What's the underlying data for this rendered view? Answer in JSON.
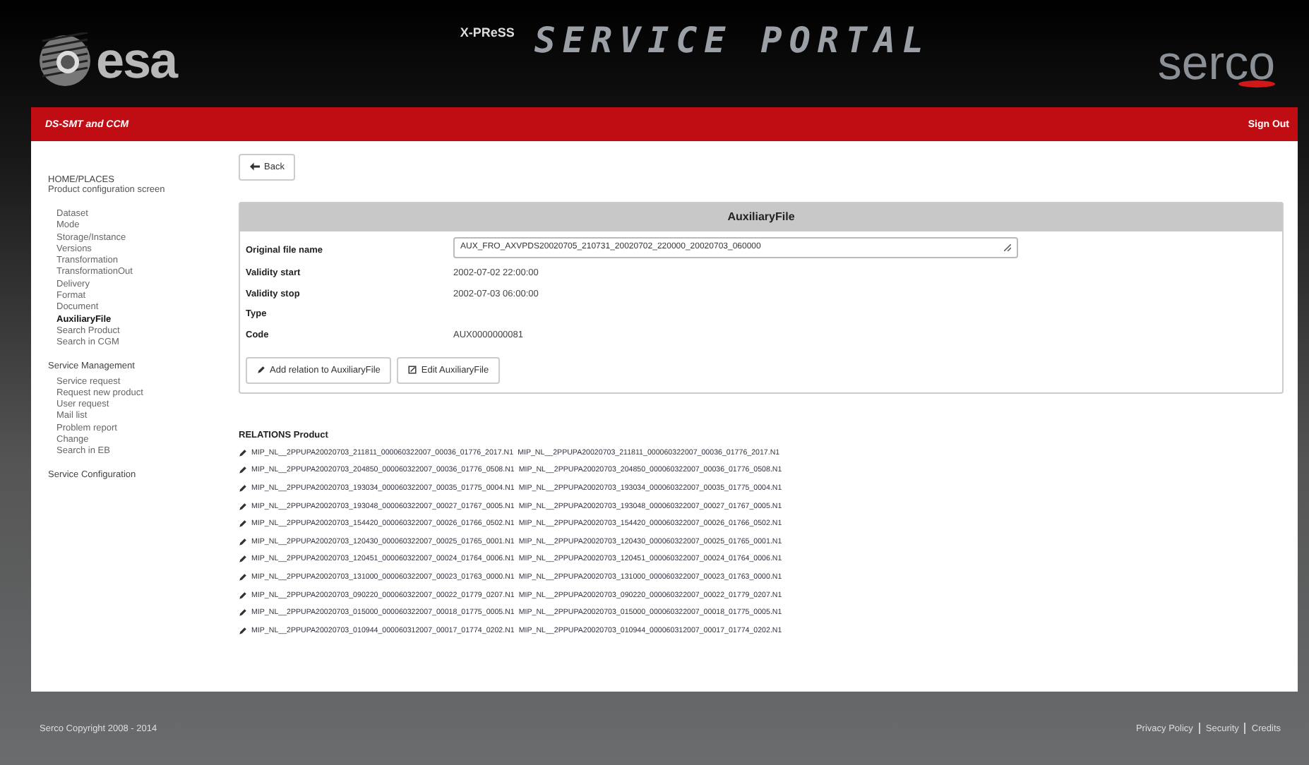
{
  "header": {
    "left_logo": "esa",
    "mission": "X-PReSS",
    "title": "SERVICE PORTAL",
    "right_logo": "serco"
  },
  "nav_bar": {
    "title": "DS-SMT and CCM",
    "sign_out": "Sign Out"
  },
  "sidebar": {
    "groups": [
      {
        "title": "HOME/PLACES",
        "subtitle": "Product configuration screen",
        "items": [
          {
            "label": "Dataset",
            "selected": false
          },
          {
            "label": "Mode",
            "selected": false
          },
          {
            "label": "Storage/Instance",
            "selected": false
          },
          {
            "label": "Versions",
            "selected": false
          },
          {
            "label": "Transformation",
            "selected": false
          },
          {
            "label": "TransformationOut",
            "selected": false
          },
          {
            "label": "Delivery",
            "selected": false
          },
          {
            "label": "Format",
            "selected": false
          },
          {
            "label": "Document",
            "selected": false
          },
          {
            "label": "AuxiliaryFile",
            "selected": true
          },
          {
            "label": "Search Product",
            "selected": false
          },
          {
            "label": "Search in CGM",
            "selected": false
          }
        ]
      },
      {
        "title": "Service Management",
        "items": [
          {
            "label": "Service request",
            "selected": false
          },
          {
            "label": "Request new product",
            "selected": false
          },
          {
            "label": "User request",
            "selected": false
          },
          {
            "label": "Mail list",
            "selected": false
          },
          {
            "label": "Problem report",
            "selected": false
          },
          {
            "label": "Change",
            "selected": false
          },
          {
            "label": "Search in EB",
            "selected": false
          }
        ]
      },
      {
        "title": "Service Configuration"
      }
    ]
  },
  "back_button": "Back",
  "panel": {
    "title": "AuxiliaryFile",
    "fields": [
      {
        "label": "Original file name",
        "kind": "input",
        "value": "AUX_FRO_AXVPDS20020705_210731_20020702_220000_20020703_060000"
      },
      {
        "label": "Validity start",
        "kind": "text",
        "value": "2002-07-02 22:00:00"
      },
      {
        "label": "Validity stop",
        "kind": "text",
        "value": "2002-07-03 06:00:00"
      },
      {
        "label": "Type",
        "kind": "text"
      },
      {
        "label": "Code",
        "kind": "text",
        "value": "AUX0000000081"
      }
    ],
    "buttons": [
      "Add relation to AuxiliaryFile",
      "Edit AuxiliaryFile"
    ]
  },
  "relations": {
    "title": "RELATIONS Product",
    "rows": [
      {
        "name": "MIP_NL__2PPUPA20020703_211811_000060322007_00036_01776_2017.N1",
        "file": "MIP_NL__2PPUPA20020703_211811_000060322007_00036_01776_2017.N1"
      },
      {
        "name": "MIP_NL__2PPUPA20020703_204850_000060322007_00036_01776_0508.N1",
        "file": "MIP_NL__2PPUPA20020703_204850_000060322007_00036_01776_0508.N1"
      },
      {
        "name": "MIP_NL__2PPUPA20020703_193034_000060322007_00035_01775_0004.N1",
        "file": "MIP_NL__2PPUPA20020703_193034_000060322007_00035_01775_0004.N1"
      },
      {
        "name": "MIP_NL__2PPUPA20020703_193048_000060322007_00027_01767_0005.N1",
        "file": "MIP_NL__2PPUPA20020703_193048_000060322007_00027_01767_0005.N1"
      },
      {
        "name": "MIP_NL__2PPUPA20020703_154420_000060322007_00026_01766_0502.N1",
        "file": "MIP_NL__2PPUPA20020703_154420_000060322007_00026_01766_0502.N1"
      },
      {
        "name": "MIP_NL__2PPUPA20020703_120430_000060322007_00025_01765_0001.N1",
        "file": "MIP_NL__2PPUPA20020703_120430_000060322007_00025_01765_0001.N1"
      },
      {
        "name": "MIP_NL__2PPUPA20020703_120451_000060322007_00024_01764_0006.N1",
        "file": "MIP_NL__2PPUPA20020703_120451_000060322007_00024_01764_0006.N1"
      },
      {
        "name": "MIP_NL__2PPUPA20020703_131000_000060322007_00023_01763_0000.N1",
        "file": "MIP_NL__2PPUPA20020703_131000_000060322007_00023_01763_0000.N1"
      },
      {
        "name": "MIP_NL__2PPUPA20020703_090220_000060322007_00022_01779_0207.N1",
        "file": "MIP_NL__2PPUPA20020703_090220_000060322007_00022_01779_0207.N1"
      },
      {
        "name": "MIP_NL__2PPUPA20020703_015000_000060322007_00018_01775_0005.N1",
        "file": "MIP_NL__2PPUPA20020703_015000_000060322007_00018_01775_0005.N1"
      },
      {
        "name": "MIP_NL__2PPUPA20020703_010944_000060312007_00017_01774_0202.N1",
        "file": "MIP_NL__2PPUPA20020703_010944_000060312007_00017_01774_0202.N1"
      }
    ]
  },
  "footer": {
    "copyright": "Serco Copyright 2008 - 2014",
    "links": [
      "Privacy Policy",
      "Security",
      "Credits"
    ]
  }
}
